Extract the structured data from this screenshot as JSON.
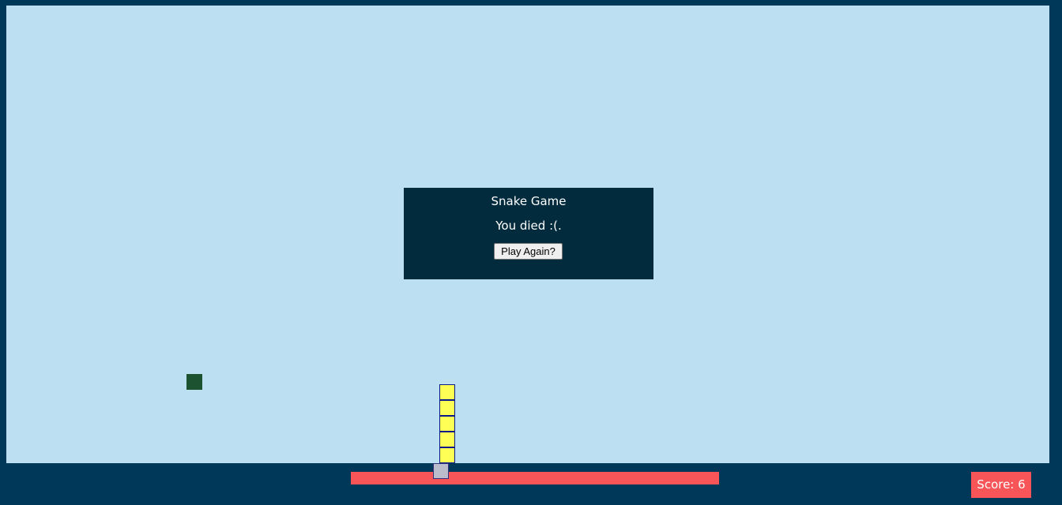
{
  "dialog": {
    "title": "Snake Game",
    "message": "You died :(.",
    "button_label": "Play Again?"
  },
  "score": {
    "label": "Score: 6",
    "value": 6
  },
  "snake": {
    "length": 6,
    "body_color": "#ffff55",
    "head_color": "#bcbdcc"
  },
  "colors": {
    "background": "#003859",
    "playfield": "#bddff2",
    "food": "#1c5230",
    "accent": "#f75557",
    "dialog": "#022c3e"
  }
}
